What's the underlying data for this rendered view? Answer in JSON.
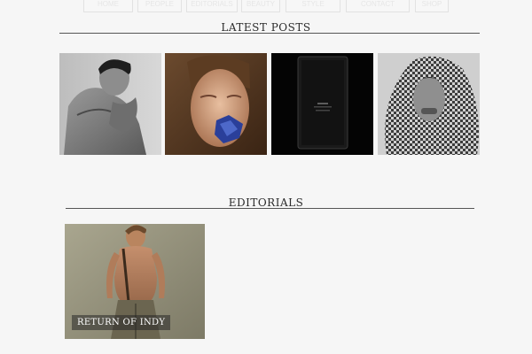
{
  "nav": {
    "items": [
      {
        "label": "HOME"
      },
      {
        "label": "PEOPLE"
      },
      {
        "label": "EDITORIALS"
      },
      {
        "label": "BEAUTY"
      },
      {
        "label": "STYLE"
      },
      {
        "label": "CONTACT"
      },
      {
        "label": "SHOP"
      }
    ]
  },
  "latest": {
    "title": "LATEST POSTS",
    "posts": [
      {
        "image": "man-shirtless-bw-portrait"
      },
      {
        "image": "man-blue-object-mouth"
      },
      {
        "image": "black-perfume-bottle"
      },
      {
        "image": "man-houndstooth-scarf-bw"
      }
    ]
  },
  "editorials": {
    "title": "EDITORIALS",
    "items": [
      {
        "caption": "RETURN OF INDY",
        "image": "shirtless-man-cargo-pants"
      }
    ]
  },
  "colors": {
    "background": "#f6f6f6",
    "rule": "#555555",
    "caption_bg": "#3a3a3a"
  }
}
